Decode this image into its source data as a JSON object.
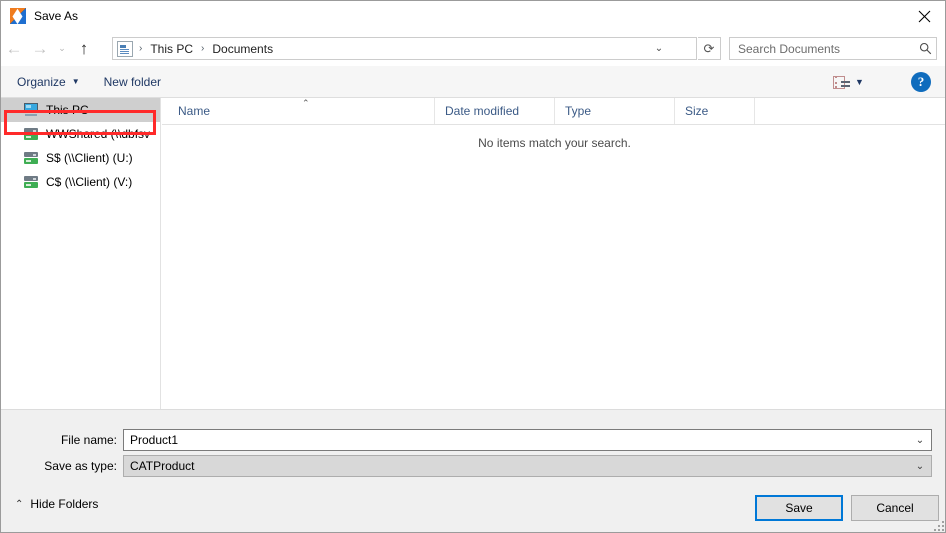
{
  "window": {
    "title": "Save As",
    "app_icon": "catia-logo-icon",
    "close_label": "✕"
  },
  "nav": {
    "back": "←",
    "forward": "→",
    "recent": "⌄",
    "up": "↑",
    "folder_icon": "document-folder-icon",
    "breadcrumbs": [
      {
        "label": "This PC"
      },
      {
        "label": "Documents"
      }
    ],
    "separator": "›",
    "dropdown": "⌄",
    "refresh": "⟳"
  },
  "search": {
    "placeholder": "Search Documents",
    "value": "",
    "icon": "search-icon"
  },
  "toolbar": {
    "organize_label": "Organize",
    "organize_caret": "▼",
    "new_folder_label": "New folder",
    "view_caret": "▼",
    "help_label": "?"
  },
  "sidebar": {
    "items": [
      {
        "label": "This PC",
        "icon": "this-pc-icon",
        "selected": true
      },
      {
        "label": "WWShared (\\\\dbfsv",
        "icon": "network-drive-icon",
        "selected": false
      },
      {
        "label": "S$ (\\\\Client) (U:)",
        "icon": "network-drive-icon",
        "selected": false
      },
      {
        "label": "C$ (\\\\Client) (V:)",
        "icon": "network-drive-icon",
        "selected": false
      }
    ],
    "highlight_color": "#ff2a2a"
  },
  "filelist": {
    "columns": [
      {
        "label": "Name",
        "sorted": true,
        "sort_caret": "⌃"
      },
      {
        "label": "Date modified",
        "sorted": false
      },
      {
        "label": "Type",
        "sorted": false
      },
      {
        "label": "Size",
        "sorted": false
      }
    ],
    "rows": [],
    "empty_message": "No items match your search."
  },
  "form": {
    "file_name_label": "File name:",
    "file_name_value": "Product1",
    "file_type_label": "Save as type:",
    "file_type_value": "CATProduct",
    "combo_arrow": "⌄"
  },
  "footer": {
    "hide_folders_label": "Hide Folders",
    "hide_folders_caret": "⌃",
    "save_label": "Save",
    "cancel_label": "Cancel"
  },
  "colors": {
    "accent": "#0078d7",
    "help_blue": "#0f6cbd",
    "highlight_red": "#ff2a2a",
    "selection_grey": "#cfcfcf",
    "panel_grey": "#f0f0f0"
  }
}
